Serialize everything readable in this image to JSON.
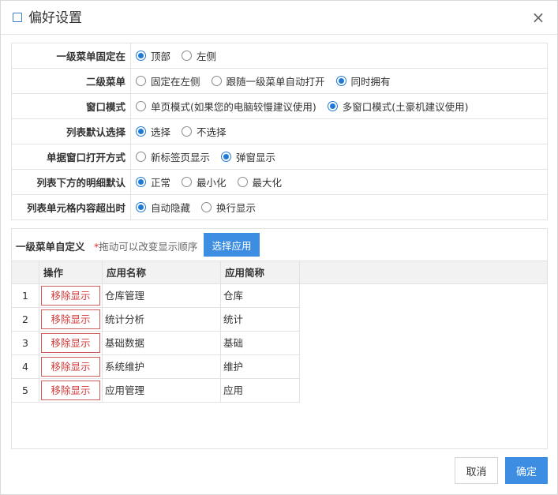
{
  "dialog": {
    "title": "偏好设置",
    "close_icon": "×"
  },
  "settings": [
    {
      "label": "一级菜单固定在",
      "options": [
        {
          "text": "顶部",
          "checked": true
        },
        {
          "text": "左侧",
          "checked": false
        }
      ]
    },
    {
      "label": "二级菜单",
      "options": [
        {
          "text": "固定在左侧",
          "checked": false
        },
        {
          "text": "跟随一级菜单自动打开",
          "checked": false
        },
        {
          "text": "同时拥有",
          "checked": true
        }
      ]
    },
    {
      "label": "窗口模式",
      "options": [
        {
          "text": "单页模式(如果您的电脑较慢建议使用)",
          "checked": false
        },
        {
          "text": "多窗口模式(土豪机建议使用)",
          "checked": true
        }
      ]
    },
    {
      "label": "列表默认选择",
      "options": [
        {
          "text": "选择",
          "checked": true
        },
        {
          "text": "不选择",
          "checked": false
        }
      ]
    },
    {
      "label": "单据窗口打开方式",
      "options": [
        {
          "text": "新标签页显示",
          "checked": false
        },
        {
          "text": "弹窗显示",
          "checked": true
        }
      ]
    },
    {
      "label": "列表下方的明细默认",
      "options": [
        {
          "text": "正常",
          "checked": true
        },
        {
          "text": "最小化",
          "checked": false
        },
        {
          "text": "最大化",
          "checked": false
        }
      ]
    },
    {
      "label": "列表单元格内容超出时",
      "options": [
        {
          "text": "自动隐藏",
          "checked": true
        },
        {
          "text": "换行显示",
          "checked": false
        }
      ]
    }
  ],
  "menu_panel": {
    "title": "一级菜单自定义",
    "hint_star": "*",
    "hint": "拖动可以改变显示顺序",
    "choose_label": "选择应用",
    "columns": [
      "操作",
      "应用名称",
      "应用简称"
    ],
    "remove_label": "移除显示",
    "rows": [
      {
        "num": "1",
        "name": "仓库管理",
        "short": "仓库"
      },
      {
        "num": "2",
        "name": "统计分析",
        "short": "统计"
      },
      {
        "num": "3",
        "name": "基础数据",
        "short": "基础"
      },
      {
        "num": "4",
        "name": "系统维护",
        "short": "维护"
      },
      {
        "num": "5",
        "name": "应用管理",
        "short": "应用"
      }
    ]
  },
  "footer": {
    "cancel_label": "取消",
    "ok_label": "确定"
  },
  "colors": {
    "accent": "#3d8ee3",
    "radio_checked": "#1e7ad6",
    "remove_red": "#d03a3a"
  }
}
